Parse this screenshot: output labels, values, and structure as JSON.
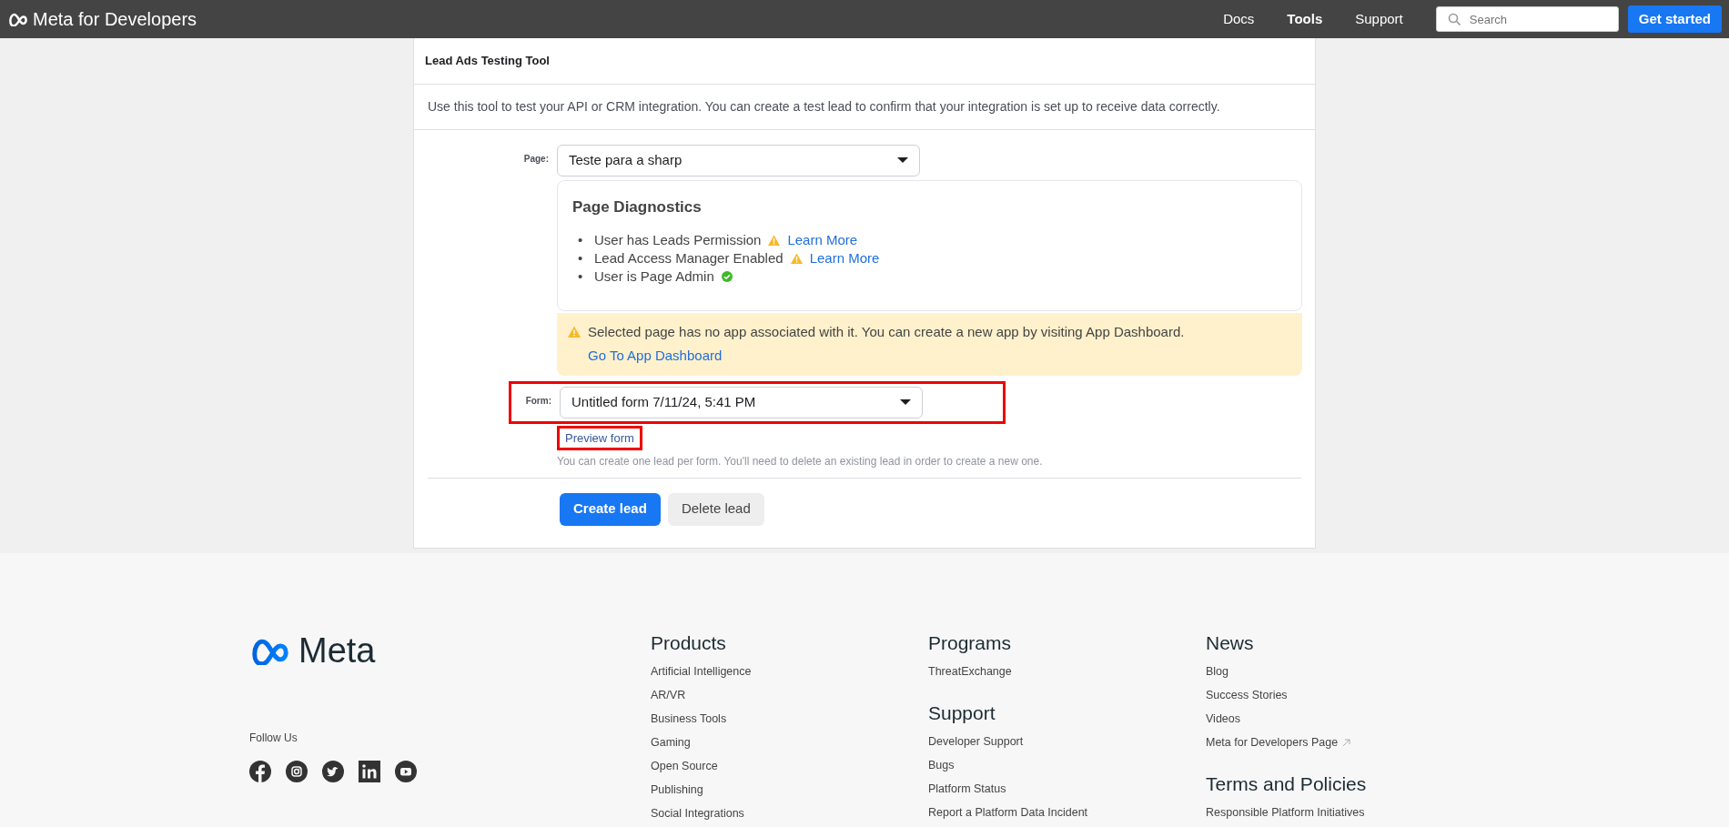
{
  "header": {
    "logo_text": "Meta for Developers",
    "nav": [
      {
        "label": "Docs",
        "selected": false
      },
      {
        "label": "Tools",
        "selected": true
      },
      {
        "label": "Support",
        "selected": false
      }
    ],
    "search": {
      "placeholder": "Search"
    },
    "cta": "Get started"
  },
  "tool": {
    "title": "Lead Ads Testing Tool",
    "description": "Use this tool to test your API or CRM integration. You can create a test lead to confirm that your integration is set up to receive data correctly.",
    "page_field": {
      "label": "Page:",
      "value": "Teste para a sharp"
    },
    "diagnostics": {
      "title": "Page Diagnostics",
      "items": [
        {
          "marker": "•",
          "text": "User has Leads Permission",
          "kind": "warning",
          "link": "Learn More"
        },
        {
          "marker": "•",
          "text": "Lead Access Manager Enabled",
          "kind": "warning",
          "link": "Learn More"
        },
        {
          "marker": "•",
          "text": "User is Page Admin",
          "kind": "ok"
        }
      ]
    },
    "alert": {
      "text": "Selected page has no app associated with it. You can create a new app by visiting App Dashboard.",
      "link": "Go To App Dashboard"
    },
    "form_field": {
      "label": "Form:",
      "value": "Untitled form 7/11/24, 5:41 PM",
      "highlighted": true
    },
    "preview_link": {
      "text": "Preview form",
      "highlighted": true
    },
    "note": "You can create one lead per form. You'll need to delete an existing lead in order to create a new one.",
    "buttons": [
      {
        "label": "Create lead",
        "kind": "primary"
      },
      {
        "label": "Delete lead",
        "kind": "secondary"
      }
    ]
  },
  "footer": {
    "logo_text": "Meta",
    "follow_label": "Follow Us",
    "columns": [
      [
        {
          "heading": "Products",
          "links": [
            {
              "text": "Artificial Intelligence"
            },
            {
              "text": "AR/VR"
            },
            {
              "text": "Business Tools"
            },
            {
              "text": "Gaming"
            },
            {
              "text": "Open Source"
            },
            {
              "text": "Publishing"
            },
            {
              "text": "Social Integrations"
            }
          ]
        }
      ],
      [
        {
          "heading": "Programs",
          "links": [
            {
              "text": "ThreatExchange"
            }
          ]
        },
        {
          "heading": "Support",
          "links": [
            {
              "text": "Developer Support"
            },
            {
              "text": "Bugs"
            },
            {
              "text": "Platform Status"
            },
            {
              "text": "Report a Platform Data Incident"
            }
          ]
        }
      ],
      [
        {
          "heading": "News",
          "links": [
            {
              "text": "Blog"
            },
            {
              "text": "Success Stories"
            },
            {
              "text": "Videos"
            },
            {
              "text": "Meta for Developers Page",
              "external": true
            }
          ]
        },
        {
          "heading": "Terms and Policies",
          "links": [
            {
              "text": "Responsible Platform Initiatives"
            }
          ]
        }
      ]
    ]
  }
}
